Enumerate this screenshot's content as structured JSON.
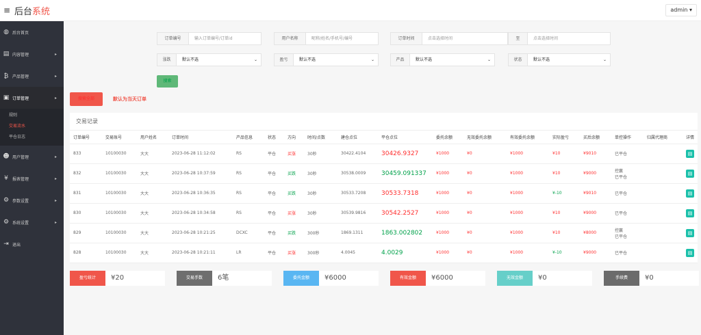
{
  "topbar": {
    "menu_icon": "hamburger-icon",
    "brand_black": "后台",
    "brand_red": "系统",
    "admin": "admin ▾"
  },
  "sidebar": {
    "items": [
      {
        "label": "后台首页",
        "icon": "dashboard-icon"
      },
      {
        "label": "内容管理",
        "icon": "content-icon"
      },
      {
        "label": "产品管理",
        "icon": "product-icon"
      },
      {
        "label": "订单管理",
        "icon": "order-icon"
      },
      {
        "label": "用户管理",
        "icon": "user-icon"
      },
      {
        "label": "报表管理",
        "icon": "report-icon"
      },
      {
        "label": "参数设置",
        "icon": "settings-icon"
      },
      {
        "label": "系统设置",
        "icon": "system-icon"
      },
      {
        "label": "退出",
        "icon": "logout-icon"
      }
    ],
    "sub": [
      "规则",
      "交易流水",
      "平仓日志"
    ]
  },
  "filters": {
    "order_no_label": "订单编号",
    "order_no_placeholder": "输入订单编号/订单id",
    "user_label": "用户名称",
    "user_placeholder": "昵称/姓名/手机号/编号",
    "order_time_label": "订单时间",
    "time_placeholder": "点击选择时间",
    "to_label": "至",
    "to_placeholder": "点击选择时间",
    "updown_label": "涨跌",
    "updown_value": "默认不选",
    "pnl_label": "盈亏",
    "pnl_value": "默认不选",
    "product_label": "产品",
    "product_value": "默认不选",
    "status_label": "状态",
    "status_value": "默认不选",
    "search_button": "搜索"
  },
  "actions": {
    "search_all": "搜索全部",
    "default_note": "默认为当天订单"
  },
  "table": {
    "title": "交易记录",
    "headers": [
      "订单编号",
      "交易账号",
      "用户姓名",
      "订单时间",
      "产品信息",
      "状态",
      "方向",
      "时间/点数",
      "建仓点位",
      "平仓点位",
      "委托余额",
      "无效委托余额",
      "有效委托余额",
      "实际盈亏",
      "买后余额",
      "单控操作",
      "归属代理商",
      "详情"
    ],
    "rows": [
      {
        "id": "833",
        "acct": "10100030",
        "name": "大大",
        "time": "2023-06-28 11:12:02",
        "product": "RS",
        "status": "平仓",
        "dir": "买涨",
        "dir_color": "red",
        "dur": "30秒",
        "open": "30422.4104",
        "close": "30426.9327",
        "close_color": "red",
        "entrust": "¥1000",
        "invalid": "¥0",
        "valid": "¥1000",
        "pnl": "¥10",
        "pnl_color": "red",
        "after": "¥9010",
        "ctrl": "已平仓"
      },
      {
        "id": "832",
        "acct": "10100030",
        "name": "大大",
        "time": "2023-06-28 10:37:59",
        "product": "RS",
        "status": "平仓",
        "dir": "买跌",
        "dir_color": "green",
        "dur": "30秒",
        "open": "30538.0009",
        "close": "30459.091337",
        "close_color": "green",
        "entrust": "¥1000",
        "invalid": "¥0",
        "valid": "¥1000",
        "pnl": "¥10",
        "pnl_color": "red",
        "after": "¥9000",
        "ctrl": "控赢\n已平仓"
      },
      {
        "id": "831",
        "acct": "10100030",
        "name": "大大",
        "time": "2023-06-28 10:36:35",
        "product": "RS",
        "status": "平仓",
        "dir": "买跌",
        "dir_color": "green",
        "dur": "30秒",
        "open": "30533.7208",
        "close": "30533.7318",
        "close_color": "red",
        "entrust": "¥1000",
        "invalid": "¥0",
        "valid": "¥1000",
        "pnl": "¥-10",
        "pnl_color": "green",
        "after": "¥9010",
        "ctrl": "已平仓"
      },
      {
        "id": "830",
        "acct": "10100030",
        "name": "大大",
        "time": "2023-06-28 10:34:58",
        "product": "RS",
        "status": "平仓",
        "dir": "买涨",
        "dir_color": "red",
        "dur": "30秒",
        "open": "30539.9816",
        "close": "30542.2527",
        "close_color": "red",
        "entrust": "¥1000",
        "invalid": "¥0",
        "valid": "¥1000",
        "pnl": "¥10",
        "pnl_color": "red",
        "after": "¥9000",
        "ctrl": "已平仓"
      },
      {
        "id": "829",
        "acct": "10100030",
        "name": "大大",
        "time": "2023-06-28 10:21:25",
        "product": "DCXC",
        "status": "平仓",
        "dir": "买跌",
        "dir_color": "green",
        "dur": "300秒",
        "open": "1869.1311",
        "close": "1863.002802",
        "close_color": "green",
        "entrust": "¥1000",
        "invalid": "¥0",
        "valid": "¥1000",
        "pnl": "¥10",
        "pnl_color": "red",
        "after": "¥8000",
        "ctrl": "控赢\n已平仓"
      },
      {
        "id": "828",
        "acct": "10100030",
        "name": "大大",
        "time": "2023-06-28 10:21:11",
        "product": "LR",
        "status": "平仓",
        "dir": "买涨",
        "dir_color": "red",
        "dur": "300秒",
        "open": "4.0045",
        "close": "4.0029",
        "close_color": "green",
        "entrust": "¥1000",
        "invalid": "¥0",
        "valid": "¥1000",
        "pnl": "¥-10",
        "pnl_color": "green",
        "after": "¥9000",
        "ctrl": "已平仓"
      }
    ]
  },
  "stats": [
    {
      "label": "盈亏统计",
      "value": "¥20",
      "color": "#f0564a"
    },
    {
      "label": "交易手数",
      "value": "6笔",
      "color": "#6e6e6e"
    },
    {
      "label": "委托金额",
      "value": "¥6000",
      "color": "#59b6f2"
    },
    {
      "label": "有效金额",
      "value": "¥6000",
      "color": "#f0564a"
    },
    {
      "label": "无效金额",
      "value": "¥0",
      "color": "#66cfc9"
    },
    {
      "label": "手续费",
      "value": "¥0",
      "color": "#6b6b6b"
    }
  ]
}
